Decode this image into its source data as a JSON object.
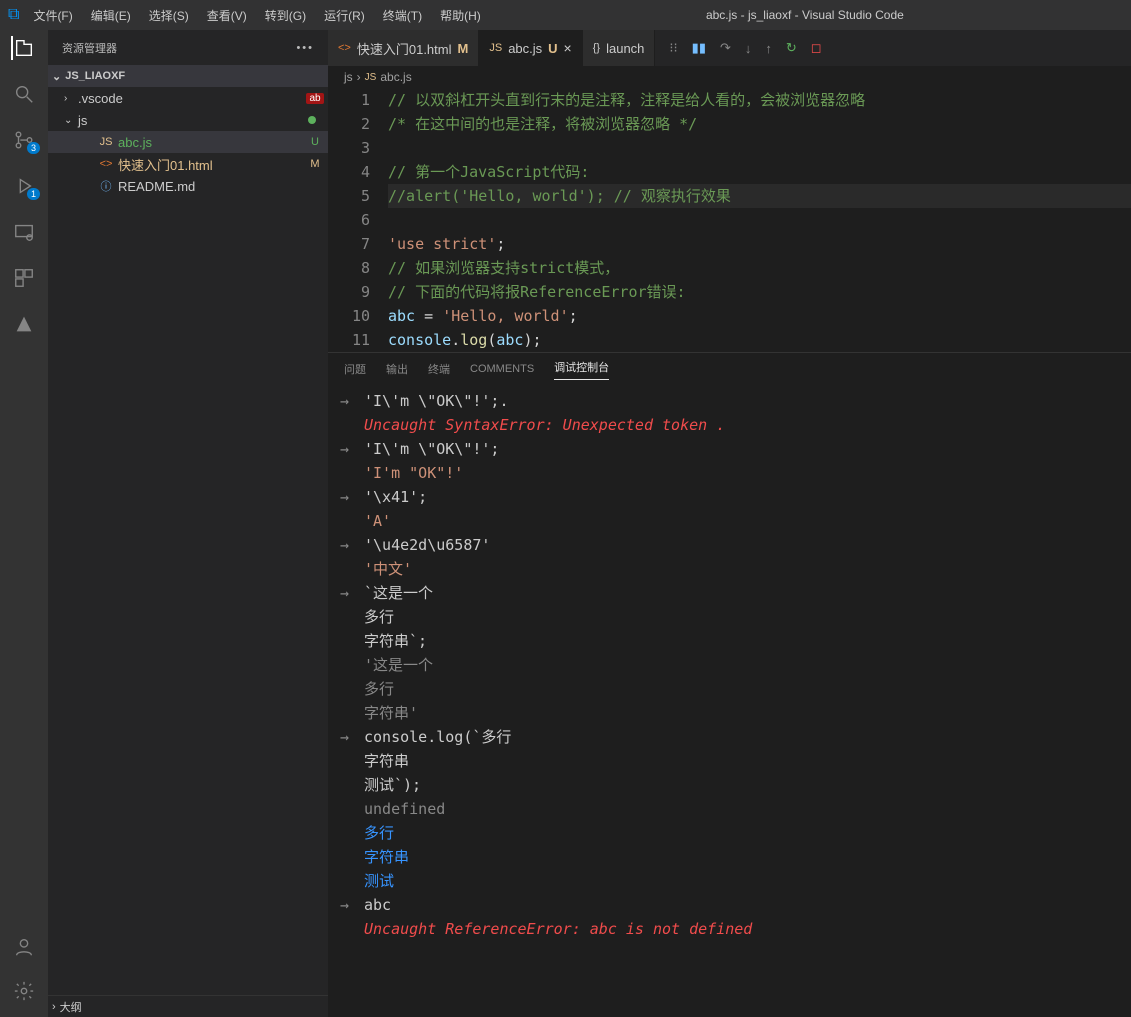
{
  "title": "abc.js - js_liaoxf - Visual Studio Code",
  "menu": [
    "文件(F)",
    "编辑(E)",
    "选择(S)",
    "查看(V)",
    "转到(G)",
    "运行(R)",
    "终端(T)",
    "帮助(H)"
  ],
  "sidebar": {
    "header": "资源管理器",
    "folder": "JS_LIAOXF",
    "items": [
      {
        "chev": "›",
        "icon": "",
        "name": ".vscode",
        "status": "ab",
        "cls": ""
      },
      {
        "chev": "⌄",
        "icon": "",
        "name": "js",
        "status": "dot",
        "cls": ""
      },
      {
        "chev": "",
        "icon": "JS",
        "name": "abc.js",
        "status": "U",
        "cls": "js",
        "sel": true,
        "statusCls": "green-u"
      },
      {
        "chev": "",
        "icon": "<>",
        "name": "快速入门01.html",
        "status": "M",
        "cls": "html",
        "statusCls": "orange-m"
      },
      {
        "chev": "",
        "icon": "ⓘ",
        "name": "README.md",
        "status": "",
        "cls": "info"
      }
    ],
    "outline": "大纲"
  },
  "activity_badges": {
    "scm": "3",
    "debug": "1"
  },
  "tabs": [
    {
      "icon": "<>",
      "label": "快速入门01.html",
      "mod": "M",
      "iconCls": "orange-html",
      "modCls": "orange-m"
    },
    {
      "icon": "JS",
      "label": "abc.js",
      "mod": "U",
      "active": true,
      "close": true,
      "iconCls": "js-yellow",
      "modCls": "green-u"
    },
    {
      "icon": "{}",
      "label": "launch",
      "iconCls": ""
    }
  ],
  "breadcrumb": [
    "js",
    "abc.js"
  ],
  "code": {
    "lines": [
      {
        "n": 1,
        "html": "<span class='c-comment'>// 以双斜杠开头直到行末的是注释，注释是给人看的，会被浏览器忽略</span>"
      },
      {
        "n": 2,
        "html": "<span class='c-comment'>/* 在这中间的也是注释，将被浏览器忽略 */</span>"
      },
      {
        "n": 3,
        "html": ""
      },
      {
        "n": 4,
        "html": "<span class='c-comment'>// 第一个JavaScript代码:</span>"
      },
      {
        "n": 5,
        "html": "<span class='c-comment'>//alert('Hello, world'); // 观察执行效果</span>",
        "hl": true
      },
      {
        "n": 6,
        "html": ""
      },
      {
        "n": 7,
        "html": "<span class='c-str'>'use strict'</span>;"
      },
      {
        "n": 8,
        "html": "<span class='c-comment'>// 如果浏览器支持strict模式，</span>"
      },
      {
        "n": 9,
        "html": "<span class='c-comment'>// 下面的代码将报ReferenceError错误:</span>"
      },
      {
        "n": 10,
        "html": "<span class='c-var'>abc</span> = <span class='c-str'>'Hello, world'</span>;"
      },
      {
        "n": 11,
        "html": "<span class='c-var'>console</span>.<span class='c-fn'>log</span>(<span class='c-var'>abc</span>);"
      }
    ]
  },
  "panel": {
    "tabs": [
      "问题",
      "输出",
      "终端",
      "COMMENTS",
      "调试控制台"
    ],
    "active": 4,
    "console": [
      {
        "arrow": "→",
        "cls": "con-white",
        "text": "'I\\'m \\\"OK\\\"!';."
      },
      {
        "arrow": "",
        "cls": "con-red-it",
        "text": "Uncaught SyntaxError: Unexpected token ."
      },
      {
        "arrow": "→",
        "cls": "con-white",
        "text": "'I\\'m \\\"OK\\\"!';"
      },
      {
        "arrow": "",
        "cls": "con-orange",
        "text": "'I'm \"OK\"!'"
      },
      {
        "arrow": "→",
        "cls": "con-white",
        "text": "'\\x41';"
      },
      {
        "arrow": "",
        "cls": "con-orange",
        "text": "'A'"
      },
      {
        "arrow": "→",
        "cls": "con-white",
        "text": "'\\u4e2d\\u6587'"
      },
      {
        "arrow": "",
        "cls": "con-orange",
        "text": "'中文'"
      },
      {
        "arrow": "→",
        "cls": "con-white",
        "text": "`这是一个"
      },
      {
        "arrow": "",
        "cls": "con-white",
        "text": "多行"
      },
      {
        "arrow": "",
        "cls": "con-white",
        "text": "字符串`;"
      },
      {
        "arrow": "",
        "cls": "con-gray",
        "text": "'这是一个"
      },
      {
        "arrow": "",
        "cls": "con-gray",
        "text": "多行"
      },
      {
        "arrow": "",
        "cls": "con-gray",
        "text": "字符串'"
      },
      {
        "arrow": "→",
        "cls": "con-white",
        "text": "console.log(`多行"
      },
      {
        "arrow": "",
        "cls": "con-white",
        "text": "字符串"
      },
      {
        "arrow": "",
        "cls": "con-white",
        "text": "测试`);"
      },
      {
        "arrow": "",
        "cls": "con-gray",
        "text": "undefined"
      },
      {
        "arrow": "",
        "cls": "con-blue",
        "text": "多行"
      },
      {
        "arrow": "",
        "cls": "con-blue",
        "text": "字符串"
      },
      {
        "arrow": "",
        "cls": "con-blue",
        "text": "测试"
      },
      {
        "arrow": "→",
        "cls": "con-white",
        "text": "abc"
      },
      {
        "arrow": "",
        "cls": "con-red-it",
        "text": "Uncaught ReferenceError: abc is not defined"
      }
    ]
  }
}
